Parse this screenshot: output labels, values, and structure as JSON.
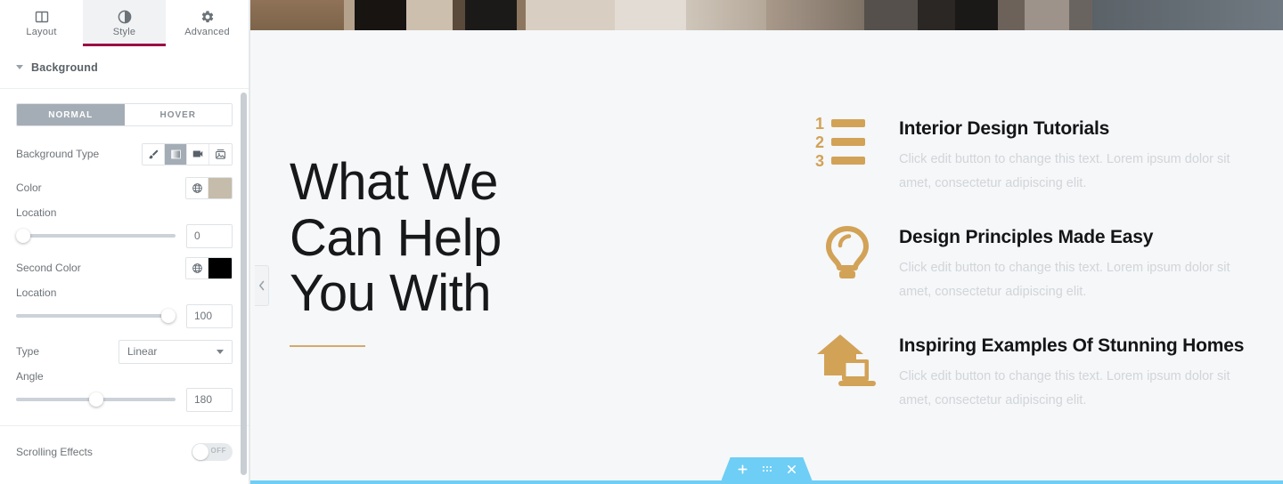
{
  "panel": {
    "tabs": [
      {
        "label": "Layout",
        "icon": "columns-icon",
        "active": false
      },
      {
        "label": "Style",
        "icon": "contrast-icon",
        "active": true
      },
      {
        "label": "Advanced",
        "icon": "gear-icon",
        "active": false
      }
    ],
    "section": {
      "title": "Background"
    },
    "state_tabs": [
      {
        "label": "NORMAL",
        "active": true
      },
      {
        "label": "HOVER",
        "active": false
      }
    ],
    "controls": {
      "background_type": {
        "label": "Background Type",
        "options": [
          {
            "name": "classic",
            "icon": "brush-icon",
            "active": false
          },
          {
            "name": "gradient",
            "icon": "gradient-icon",
            "active": true
          },
          {
            "name": "video",
            "icon": "video-camera-icon",
            "active": false
          },
          {
            "name": "slideshow",
            "icon": "slideshow-icon",
            "active": false
          }
        ]
      },
      "color": {
        "label": "Color",
        "value": "#c6bcab",
        "globe_icon": "globe-icon"
      },
      "location_first": {
        "label": "Location",
        "value": "0",
        "knob_percent": 0
      },
      "second_color": {
        "label": "Second Color",
        "value": "#000000",
        "globe_icon": "globe-icon"
      },
      "location_second": {
        "label": "Location",
        "value": "100",
        "knob_percent": 100
      },
      "type": {
        "label": "Type",
        "value": "Linear"
      },
      "angle": {
        "label": "Angle",
        "value": "180",
        "knob_percent": 50
      },
      "scrolling_effects": {
        "label": "Scrolling Effects",
        "state": "OFF",
        "on": false
      }
    },
    "collapse_handle_icon": "chevron-left-icon"
  },
  "canvas": {
    "hero": {
      "title": "What We\nCan Help\nYou With",
      "accent_color": "#d4a96a",
      "features": [
        {
          "icon": "numbered-list-icon",
          "title": "Interior Design Tutorials",
          "description": "Click edit button to change this text. Lorem ipsum dolor sit amet, consectetur adipiscing elit."
        },
        {
          "icon": "lightbulb-icon",
          "title": "Design Principles Made Easy",
          "description": "Click edit button to change this text. Lorem ipsum dolor sit amet, consectetur adipiscing elit."
        },
        {
          "icon": "house-laptop-icon",
          "title": "Inspiring Examples Of Stunning Homes",
          "description": "Click edit button to change this text. Lorem ipsum dolor sit amet, consectetur adipiscing elit."
        }
      ]
    },
    "section_toolbar": {
      "color": "#6ecef5",
      "actions": [
        {
          "name": "add-section",
          "icon": "plus-icon"
        },
        {
          "name": "drag-section",
          "icon": "drag-dots-icon"
        },
        {
          "name": "delete-section",
          "icon": "close-icon"
        }
      ]
    }
  }
}
